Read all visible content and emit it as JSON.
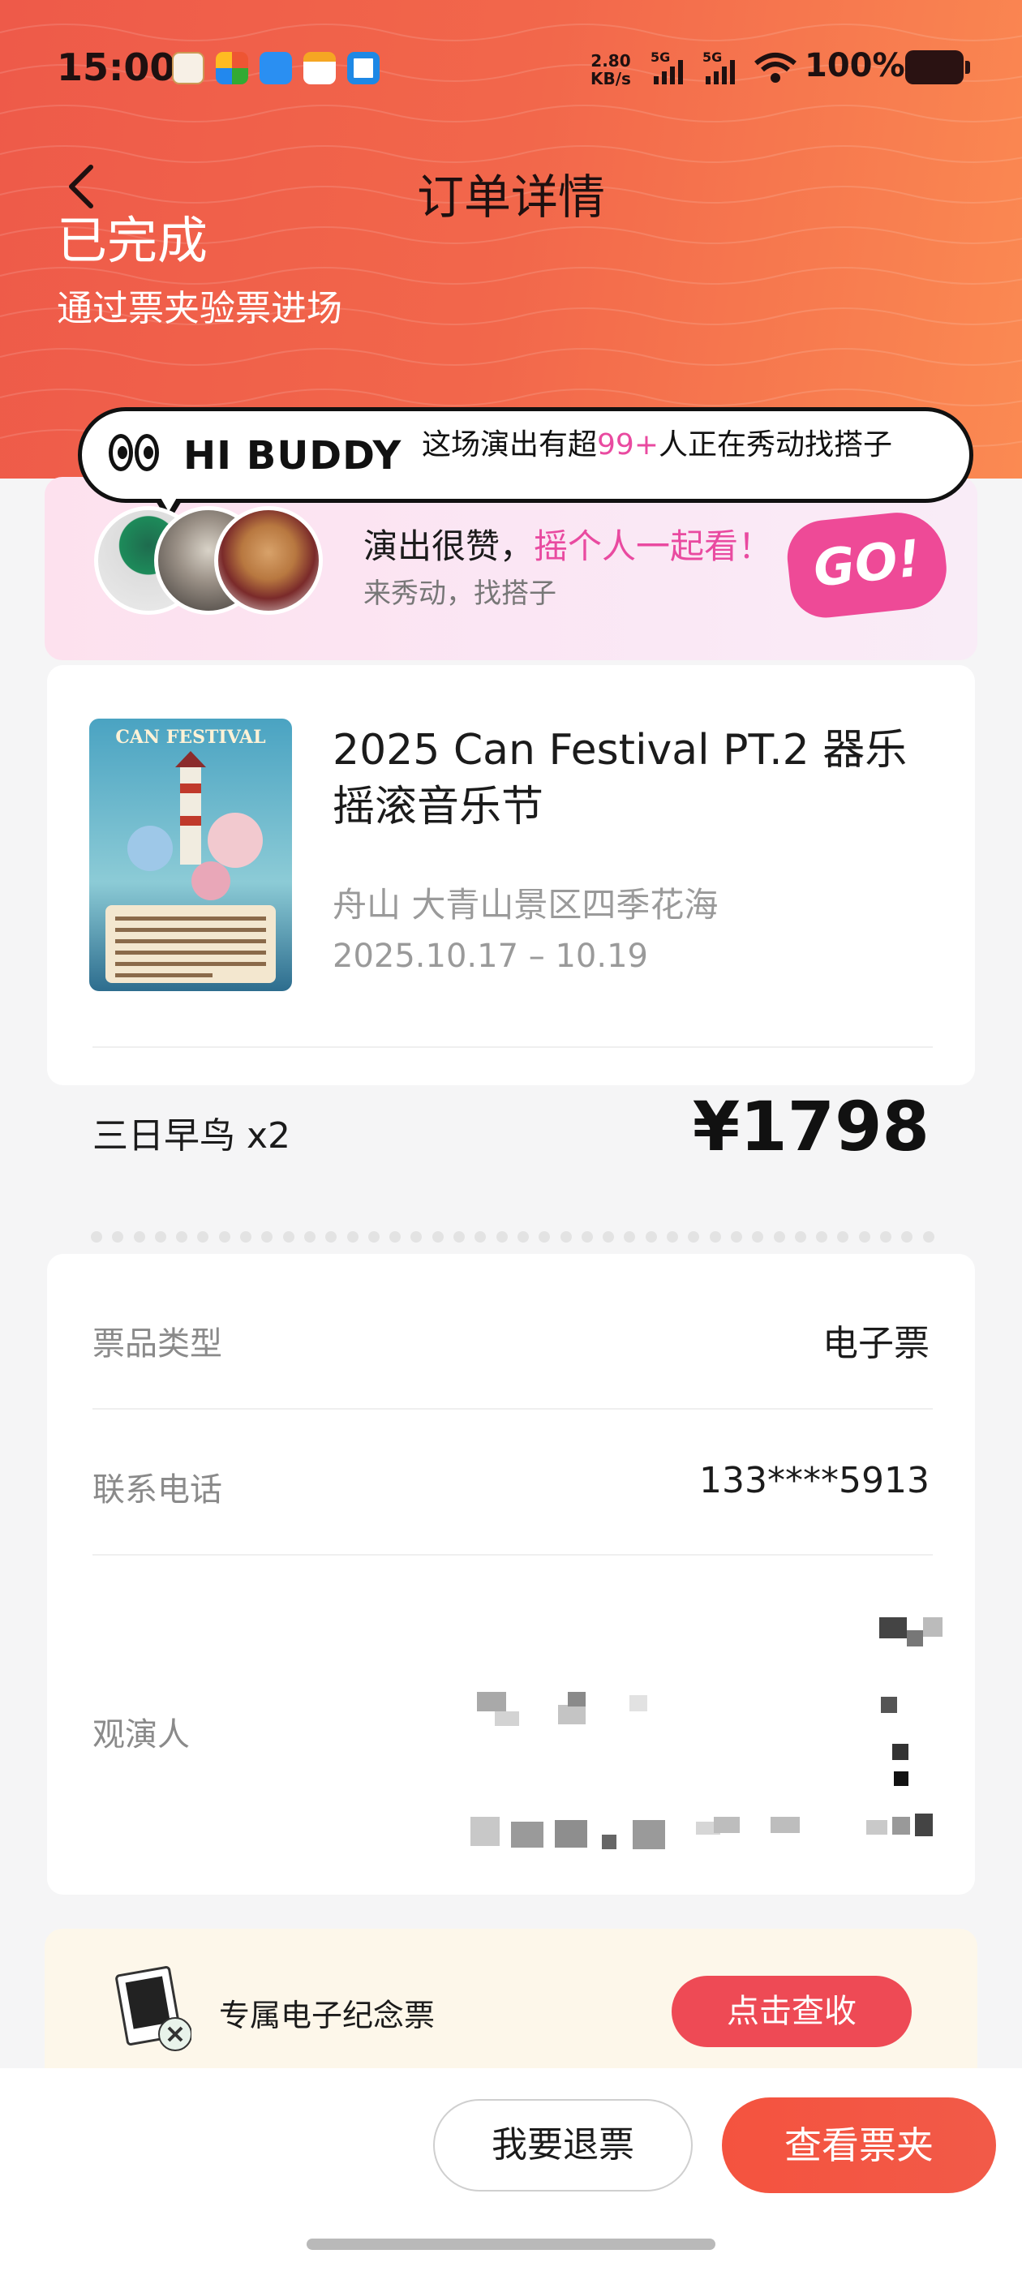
{
  "status_bar": {
    "time": "15:00",
    "net_speed_value": "2.80",
    "net_speed_unit": "KB/s",
    "signal1": "5G",
    "signal2": "5G",
    "battery": "100%",
    "icons": [
      "browser-icon",
      "puzzle-app-icon",
      "ecloud-icon",
      "calendar-app-icon",
      "files-app-icon"
    ]
  },
  "header": {
    "title": "订单详情",
    "status": "已完成",
    "status_sub": "通过票夹验票进场"
  },
  "buddy_banner": {
    "brand": "HI BUDDY",
    "bubble_pre": "这场演出有超",
    "bubble_count": "99+",
    "bubble_post": "人正在秀动找搭子",
    "main_text": "演出很赞，",
    "main_highlight": "摇个人一起看！",
    "sub_text": "来秀动，找搭子",
    "go_label": "GO!"
  },
  "event": {
    "name": "2025 Can Festival PT.2 器乐摇滚音乐节",
    "location": "舟山 大青山景区四季花海",
    "dates": "2025.10.17 – 10.19",
    "poster_title": "CAN FESTIVAL",
    "ticket_type": "三日早鸟 x2",
    "price": "¥1798"
  },
  "details": {
    "ticket_kind_label": "票品类型",
    "ticket_kind_value": "电子票",
    "phone_label": "联系电话",
    "phone_value": "133****5913",
    "attendee_label": "观演人"
  },
  "souvenir": {
    "label": "专属电子纪念票",
    "button": "点击查收"
  },
  "actions": {
    "refund": "我要退票",
    "view_wallet": "查看票夹"
  },
  "colors": {
    "header_start": "#ee5a49",
    "header_end": "#fb8a52",
    "accent_pink": "#e94aa0",
    "primary_red": "#f4533f"
  }
}
